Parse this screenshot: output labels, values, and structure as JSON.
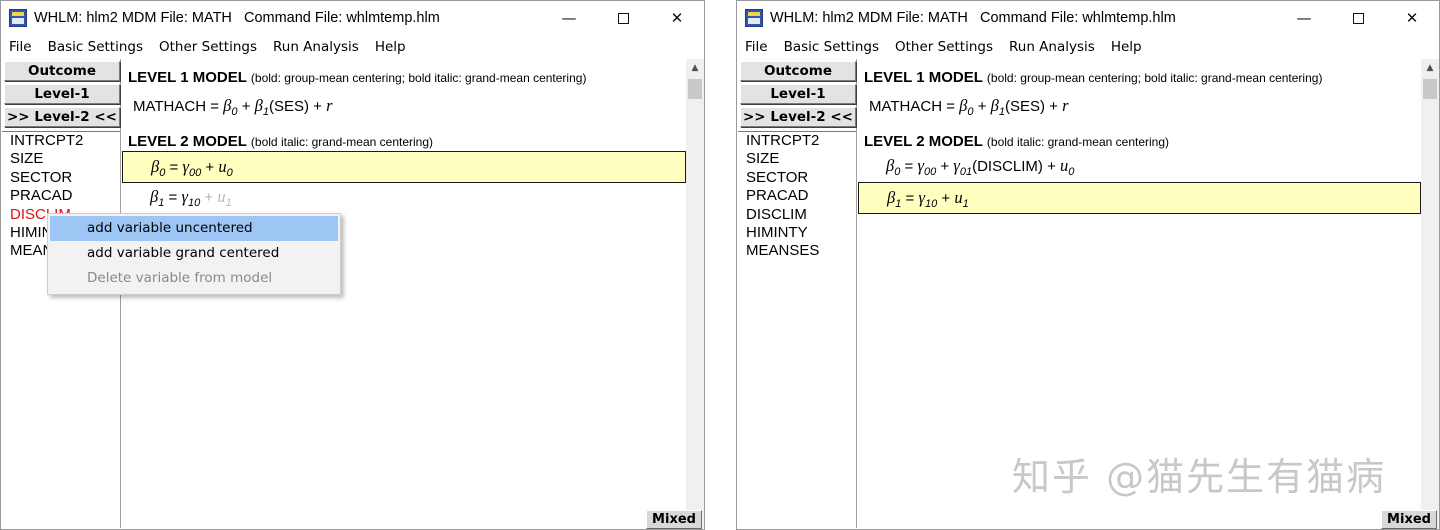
{
  "left_window": {
    "title": "WHLM: hlm2 MDM File: MATH   Command File: whlmtemp.hlm",
    "menu": [
      "File",
      "Basic Settings",
      "Other Settings",
      "Run Analysis",
      "Help"
    ],
    "buttons": {
      "outcome": "Outcome",
      "level1": "Level-1",
      "level2": ">> Level-2 <<"
    },
    "variables": [
      "INTRCPT2",
      "SIZE",
      "SECTOR",
      "PRACAD",
      "DISCLIM",
      "HIMIN",
      "MEAN"
    ],
    "highlighted_variable": "DISCLIM",
    "level1_heading": "LEVEL 1 MODEL",
    "level1_note": "(bold: group-mean centering; bold italic: grand-mean centering)",
    "level1_eq": {
      "lhs": "MATHACH",
      "eq": "=",
      "b": "β",
      "s0": "0",
      "plus1": "+",
      "s1": "1",
      "ses": "(SES)",
      "plus2": "+",
      "r": "r"
    },
    "level2_heading": "LEVEL 2 MODEL",
    "level2_note": "(bold italic: grand-mean centering)",
    "eq0": {
      "b": "β",
      "bsub": "0",
      "eq": "=",
      "g": "γ",
      "gsub": "00",
      "plus": "+",
      "u": "u",
      "usub": "0"
    },
    "eq1": {
      "b": "β",
      "bsub": "1",
      "eq": "=",
      "g": "γ",
      "gsub": "10",
      "plus": "+",
      "u": "u",
      "usub": "1"
    },
    "context_menu": [
      "add variable uncentered",
      "add variable grand centered",
      "Delete variable from model"
    ],
    "mixed": "Mixed"
  },
  "right_window": {
    "title": "WHLM: hlm2 MDM File: MATH   Command File: whlmtemp.hlm",
    "menu": [
      "File",
      "Basic Settings",
      "Other Settings",
      "Run Analysis",
      "Help"
    ],
    "buttons": {
      "outcome": "Outcome",
      "level1": "Level-1",
      "level2": ">> Level-2 <<"
    },
    "variables": [
      "INTRCPT2",
      "SIZE",
      "SECTOR",
      "PRACAD",
      "DISCLIM",
      "HIMINTY",
      "MEANSES"
    ],
    "level1_heading": "LEVEL 1 MODEL",
    "level1_note": "(bold: group-mean centering; bold italic: grand-mean centering)",
    "level1_eq": {
      "lhs": "MATHACH",
      "eq": "=",
      "b": "β",
      "s0": "0",
      "plus1": "+",
      "s1": "1",
      "ses": "(SES)",
      "plus2": "+",
      "r": "r"
    },
    "level2_heading": "LEVEL 2 MODEL",
    "level2_note": "(bold italic: grand-mean centering)",
    "eq0": {
      "b": "β",
      "bsub": "0",
      "eq": "=",
      "g": "γ",
      "gsub": "00",
      "plus": "+",
      "g2sub": "01",
      "var": "(DISCLIM)",
      "plus2": "+",
      "u": "u",
      "usub": "0"
    },
    "eq1": {
      "b": "β",
      "bsub": "1",
      "eq": "=",
      "g": "γ",
      "gsub": "10",
      "plus": "+",
      "u": "u",
      "usub": "1"
    },
    "mixed": "Mixed"
  },
  "watermark": "知乎 @猫先生有猫病",
  "colors": {
    "highlight_row": "#ffffc0",
    "menu_hover": "#9dc6f5",
    "red_variable": "#e01010"
  },
  "icons": {
    "minimize": "—",
    "close": "✕",
    "scroll_up": "▲"
  }
}
